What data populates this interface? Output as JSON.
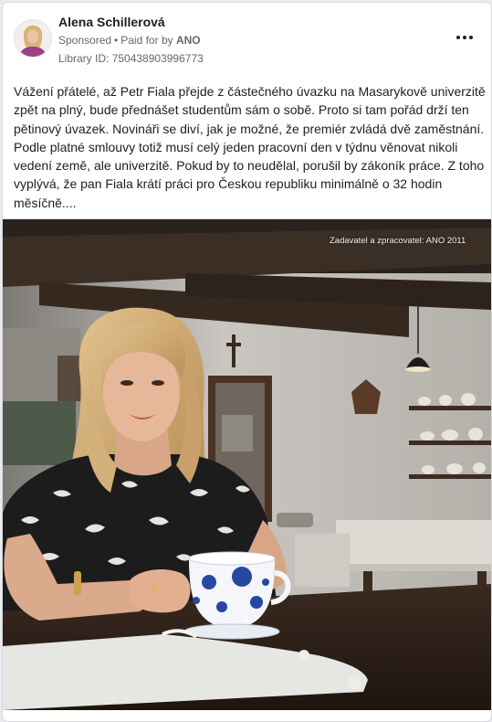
{
  "post": {
    "author": "Alena Schillerová",
    "sponsored_label": "Sponsored",
    "paid_for_prefix": "Paid for by",
    "paid_for_by": "ANO",
    "library_id": "Library ID: 750438903996773",
    "text_lines": [
      "Vážení přátelé, až Petr Fiala přejde z částečného úvazku na Masarykově univerzitě",
      "zpět na plný, bude přednášet studentům sám o sobě. Proto si tam pořád drží ten",
      "pětinový úvazek. Novináři se diví, jak je možné, že premiér zvládá dvě zaměstnání.",
      "Podle platné smlouvy totiž musí celý jeden pracovní den v týdnu věnovat nikoli",
      "vedení země, ale univerzitě. Pokud by to neudělal, porušil by zákoník práce. Z toho",
      "vyplývá, že pan Fiala krátí práci pro Českou republiku minimálně o 32 hodin",
      "měsíčně...."
    ]
  },
  "media": {
    "watermark": "Zadavatel a zpracovatel: ANO 2011",
    "icon": "ad-photo-woman-with-teacup"
  },
  "icons": {
    "more": "more-options-icon",
    "avatar": "avatar-photo"
  },
  "colors": {
    "card_bg": "#ffffff",
    "text": "#1c1e21",
    "secondary_text": "#65676b",
    "page_bg": "#e9ebee"
  }
}
